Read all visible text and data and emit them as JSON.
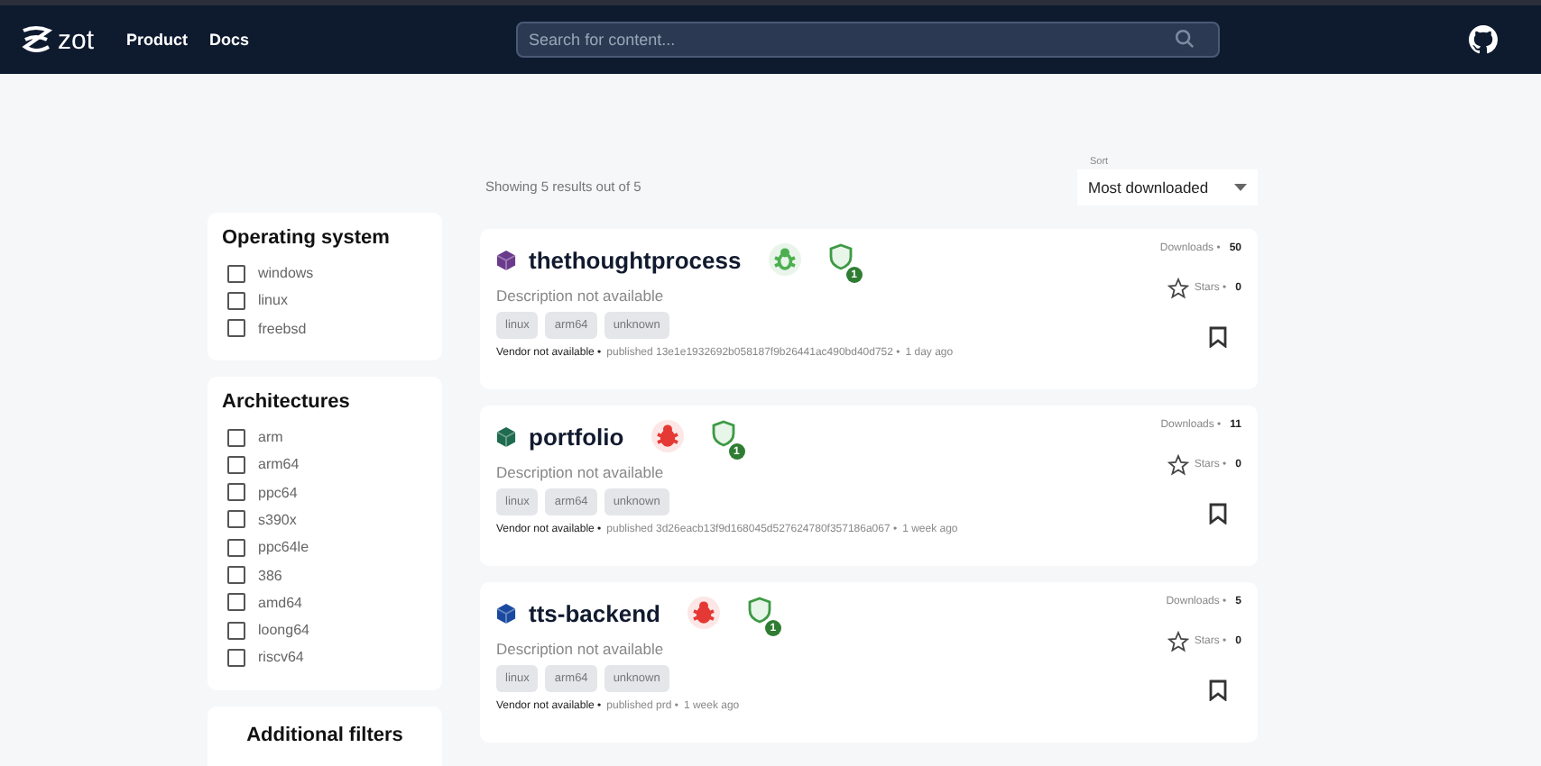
{
  "header": {
    "logo": "zot",
    "nav": [
      "Product",
      "Docs"
    ],
    "search": {
      "placeholder": "Search for content..."
    }
  },
  "results": {
    "summary": "Showing 5 results out of 5",
    "sort": {
      "label": "Sort",
      "value": "Most downloaded"
    }
  },
  "filters": [
    {
      "title": "Operating system",
      "options": [
        {
          "label": "windows",
          "checked": false
        },
        {
          "label": "linux",
          "checked": false
        },
        {
          "label": "freebsd",
          "checked": false
        }
      ]
    },
    {
      "title": "Architectures",
      "options": [
        {
          "label": "arm",
          "checked": false
        },
        {
          "label": "arm64",
          "checked": false
        },
        {
          "label": "ppc64",
          "checked": false
        },
        {
          "label": "s390x",
          "checked": false
        },
        {
          "label": "ppc64le",
          "checked": false
        },
        {
          "label": "386",
          "checked": false
        },
        {
          "label": "amd64",
          "checked": false
        },
        {
          "label": "loong64",
          "checked": false
        },
        {
          "label": "riscv64",
          "checked": false
        }
      ]
    },
    {
      "title": "Additional filters"
    }
  ],
  "repos": [
    {
      "name": "thethoughtprocess",
      "color": "#6b3a8c",
      "bug": {
        "color": "#4caf50"
      },
      "signatures": "1",
      "description": "Description not available",
      "tags": [
        "linux",
        "arm64",
        "unknown"
      ],
      "vendor": "Vendor not available •",
      "published": "published 13e1e1932692b058187f9b26441ac490bd40d752 •",
      "age": "1 day ago",
      "downloads_label": "Downloads •",
      "downloads": "50",
      "stars_label": "Stars •",
      "stars": "0",
      "bookmarked": false
    },
    {
      "name": "portfolio",
      "color": "#1f6b4f",
      "bug": {
        "color": "#e53935"
      },
      "signatures": "1",
      "description": "Description not available",
      "tags": [
        "linux",
        "arm64",
        "unknown"
      ],
      "vendor": "Vendor not available •",
      "published": "published 3d26eacb13f9d168045d527624780f357186a067 •",
      "age": "1 week ago",
      "downloads_label": "Downloads •",
      "downloads": "11",
      "stars_label": "Stars •",
      "stars": "0",
      "bookmarked": false
    },
    {
      "name": "tts-backend",
      "color": "#1a4aa0",
      "bug": {
        "color": "#e53935"
      },
      "signatures": "1",
      "description": "Description not available",
      "tags": [
        "linux",
        "arm64",
        "unknown"
      ],
      "vendor": "Vendor not available •",
      "published": "published prd •",
      "age": "1 week ago",
      "downloads_label": "Downloads •",
      "downloads": "5",
      "stars_label": "Stars •",
      "stars": "0",
      "bookmarked": false
    }
  ]
}
